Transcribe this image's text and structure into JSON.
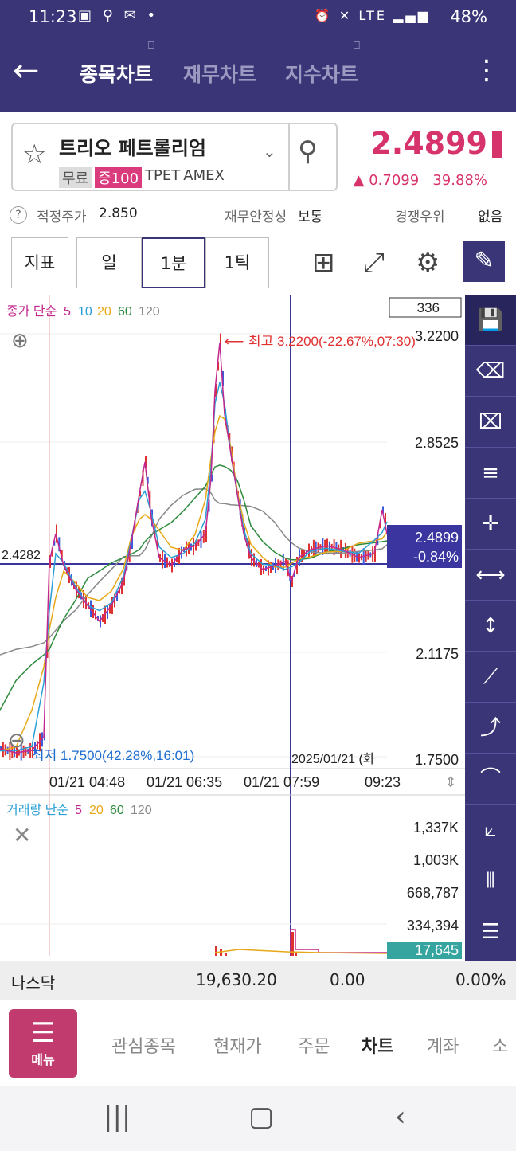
{
  "status": {
    "time": "11:23",
    "left_icons": "▣ ⚲ ✉ •",
    "right_icons": "⏰ ✕ LTE ▂▄▆",
    "battery": "48%"
  },
  "appbar": {
    "back_icon": "arrow-left",
    "tabs": [
      {
        "label": "종목차트"
      },
      {
        "label": "재무차트"
      },
      {
        "label": "지수차트"
      }
    ]
  },
  "stock": {
    "name": "트리오 페트롤리엄",
    "tags": [
      "무료",
      "증100",
      "TPET",
      "AMEX"
    ],
    "price": "2.4899",
    "change": "▲ 0.7099",
    "change_pct": "39.88%"
  },
  "info": {
    "q": "?",
    "fair_label": "적정주가",
    "fair_value": "2.850",
    "fin_label": "재무안정성",
    "fin_value": "보통",
    "comp_label": "경쟁우위",
    "comp_value": "없음"
  },
  "toolbar": {
    "indicator": "지표",
    "day": "일",
    "minute": "1분",
    "tick": "1틱"
  },
  "chart": {
    "legend_price": "종가 단순",
    "legend_price_periods": [
      "5",
      "10",
      "20",
      "60",
      "120"
    ],
    "box_value": "336",
    "y_ticks": [
      "3.2200",
      "2.8525",
      "2.1175",
      "1.7500"
    ],
    "high_label": "최고 3.2200(-22.67%,07:30)",
    "low_label": "최저 1.7500(42.28%,16:01)",
    "hline_label": "2.4282",
    "current_price": "2.4899",
    "current_pct": "-0.84%",
    "crosshair_label": "2025/01/21 (화",
    "x_ticks": [
      "01/21 04:48",
      "01/21 06:35",
      "01/21 07:59",
      "09:23"
    ],
    "legend_vol": "거래량 단순",
    "legend_vol_periods": [
      "5",
      "20",
      "60",
      "120"
    ],
    "vol_ticks": [
      "1,337K",
      "1,003K",
      "668,787",
      "334,394"
    ],
    "vol_current": "17,645",
    "colors": {
      "p5": "#c2278e",
      "p10": "#2a9fd6",
      "p20": "#e6a817",
      "p60": "#2e8b3e",
      "p120": "#888888",
      "up": "#e03131",
      "down": "#3b5bdb",
      "accent": "#3a3577"
    }
  },
  "index_row": {
    "name": "나스닥",
    "value": "19,630.20",
    "change": "0.00",
    "pct": "0.00%"
  },
  "nav": {
    "menu": "메뉴",
    "items": [
      "관심종목",
      "현재가",
      "주문",
      "차트",
      "계좌",
      "소"
    ]
  }
}
